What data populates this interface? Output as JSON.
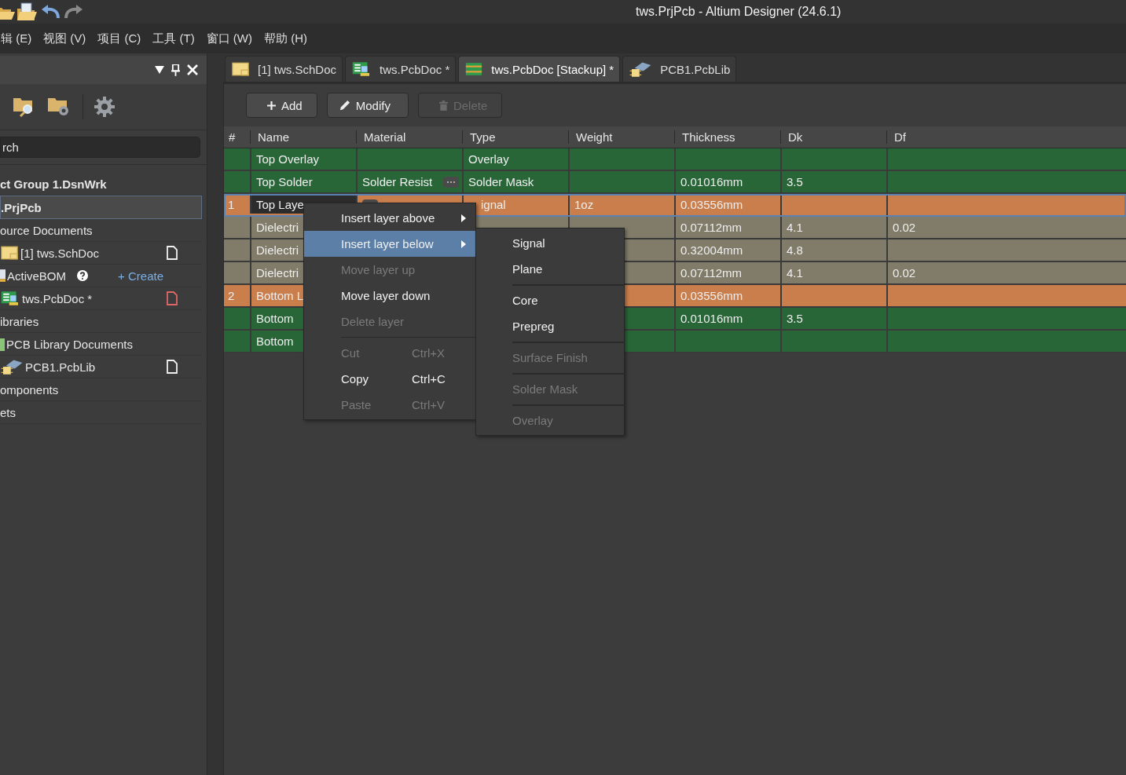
{
  "window": {
    "title": "tws.PrjPcb - Altium Designer (24.6.1)"
  },
  "menu_bar": [
    "辑 (E)",
    "视图 (V)",
    "项目 (C)",
    "工具 (T)",
    "窗口 (W)",
    "帮助 (H)"
  ],
  "sidebar": {
    "search": {
      "value": "rch"
    },
    "items": [
      {
        "kind": "group",
        "label": "ct Group 1.DsnWrk",
        "selected": false
      },
      {
        "kind": "project",
        "label": ".PrjPcb",
        "selected": true
      },
      {
        "kind": "folder",
        "label": "ource Documents",
        "selected": false
      },
      {
        "kind": "schematic",
        "label": "[1] tws.SchDoc",
        "selected": false,
        "modified": false
      },
      {
        "kind": "bom",
        "label": "ActiveBOM",
        "selected": false,
        "action": "+ Create"
      },
      {
        "kind": "pcb",
        "label": "tws.PcbDoc *",
        "selected": false,
        "modified": true
      },
      {
        "kind": "folder",
        "label": "ibraries",
        "selected": false
      },
      {
        "kind": "library-folder",
        "label": "PCB Library Documents",
        "selected": false
      },
      {
        "kind": "library",
        "label": "PCB1.PcbLib",
        "selected": false,
        "modified": false
      },
      {
        "kind": "folder",
        "label": "omponents",
        "selected": false
      },
      {
        "kind": "folder",
        "label": "ets",
        "selected": false
      }
    ]
  },
  "tabs": [
    {
      "kind": "schematic",
      "label": "[1] tws.SchDoc",
      "selected": false
    },
    {
      "kind": "pcb",
      "label": "tws.PcbDoc *",
      "selected": false
    },
    {
      "kind": "stackup",
      "label": "tws.PcbDoc [Stackup] *",
      "selected": true
    },
    {
      "kind": "library",
      "label": "PCB1.PcbLib",
      "selected": false
    }
  ],
  "toolbar": [
    {
      "kind": "add",
      "label": "Add",
      "disabled": false
    },
    {
      "kind": "modify",
      "label": "Modify",
      "disabled": false
    },
    {
      "kind": "delete",
      "label": "Delete",
      "disabled": true
    }
  ],
  "table": {
    "columns": [
      "#",
      "Name",
      "Material",
      "Type",
      "Weight",
      "Thickness",
      "Dk",
      "Df"
    ],
    "rows": [
      {
        "color": "#286638",
        "selected": false,
        "name": "Top Overlay",
        "type": "Overlay"
      },
      {
        "color": "#286638",
        "selected": false,
        "name": "Top Solder",
        "material": "Solder Resist",
        "material_button": true,
        "type": "Solder Mask",
        "thickness": "0.01016mm",
        "dk": "3.5"
      },
      {
        "color": "#c97e4c",
        "selected": true,
        "number": "1",
        "name": "Top Laye",
        "material_button": true,
        "type": "ignal",
        "weight": "1oz",
        "thickness": "0.03556mm"
      },
      {
        "color": "#817c69",
        "selected": false,
        "name": "Dielectri",
        "thickness": "0.07112mm",
        "dk": "4.1",
        "df": "0.02"
      },
      {
        "color": "#817c69",
        "selected": false,
        "name": "Dielectri",
        "thickness": "0.32004mm",
        "dk": "4.8"
      },
      {
        "color": "#817c69",
        "selected": false,
        "name": "Dielectri",
        "thickness": "0.07112mm",
        "dk": "4.1",
        "df": "0.02"
      },
      {
        "color": "#c97e4c",
        "selected": false,
        "number": "2",
        "name": "Bottom L",
        "thickness": "0.03556mm"
      },
      {
        "color": "#286638",
        "selected": false,
        "name": "Bottom",
        "thickness": "0.01016mm",
        "dk": "3.5"
      },
      {
        "color": "#286638",
        "selected": false,
        "name": "Bottom"
      }
    ]
  },
  "context_menu": {
    "items": [
      {
        "kind": "item",
        "label": "Insert layer above",
        "submenu": true,
        "disabled": false,
        "selected": false
      },
      {
        "kind": "item",
        "label": "Insert layer below",
        "submenu": true,
        "disabled": false,
        "selected": true
      },
      {
        "kind": "item",
        "label": "Move layer up",
        "submenu": false,
        "disabled": true,
        "selected": false
      },
      {
        "kind": "item",
        "label": "Move layer down",
        "submenu": false,
        "disabled": false,
        "selected": false
      },
      {
        "kind": "item",
        "label": "Delete layer",
        "submenu": false,
        "disabled": true,
        "selected": false
      },
      {
        "kind": "separator"
      },
      {
        "kind": "item",
        "label": "Cut",
        "shortcut": "Ctrl+X",
        "submenu": false,
        "disabled": true,
        "selected": false
      },
      {
        "kind": "item",
        "label": "Copy",
        "shortcut": "Ctrl+C",
        "submenu": false,
        "disabled": false,
        "selected": false
      },
      {
        "kind": "item",
        "label": "Paste",
        "shortcut": "Ctrl+V",
        "submenu": false,
        "disabled": true,
        "selected": false
      }
    ]
  },
  "submenu": {
    "items": [
      {
        "kind": "item",
        "label": "Signal",
        "disabled": false
      },
      {
        "kind": "item",
        "label": "Plane",
        "disabled": false
      },
      {
        "kind": "separator"
      },
      {
        "kind": "item",
        "label": "Core",
        "disabled": false
      },
      {
        "kind": "item",
        "label": "Prepreg",
        "disabled": false
      },
      {
        "kind": "separator"
      },
      {
        "kind": "item",
        "label": "Surface Finish",
        "disabled": true
      },
      {
        "kind": "separator"
      },
      {
        "kind": "item",
        "label": "Solder Mask",
        "disabled": true
      },
      {
        "kind": "separator"
      },
      {
        "kind": "item",
        "label": "Overlay",
        "disabled": true
      }
    ]
  }
}
